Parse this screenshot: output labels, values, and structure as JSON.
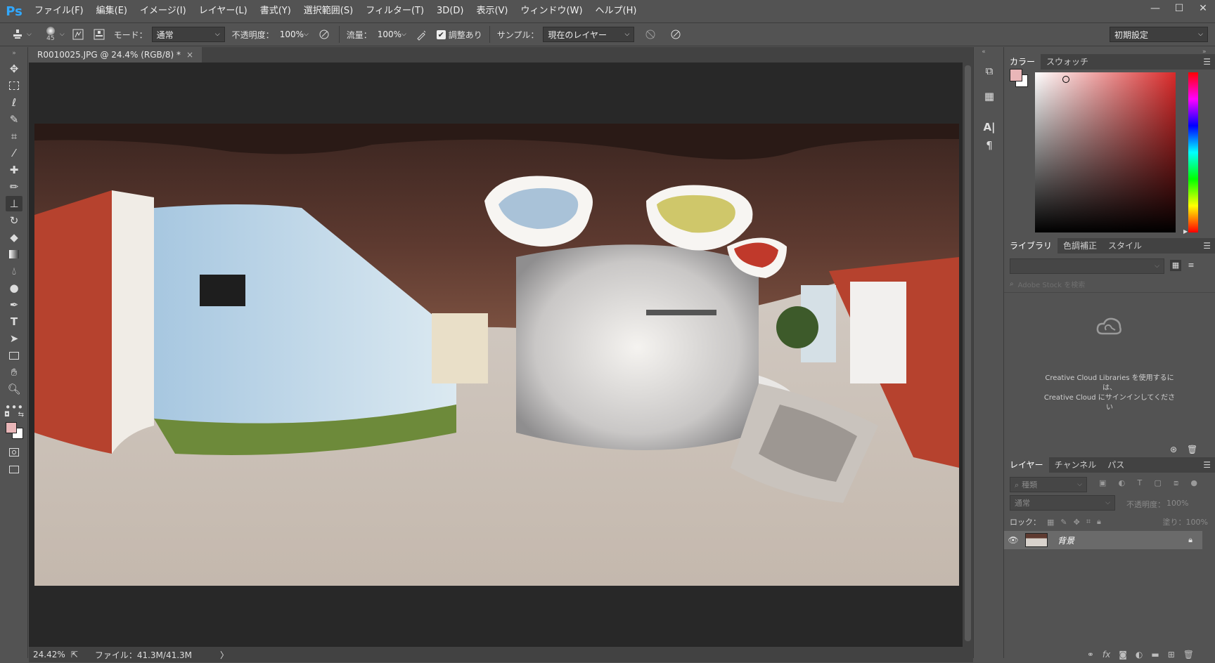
{
  "app": {
    "logo": "Ps"
  },
  "menu": [
    "ファイル(F)",
    "編集(E)",
    "イメージ(I)",
    "レイヤー(L)",
    "書式(Y)",
    "選択範囲(S)",
    "フィルター(T)",
    "3D(D)",
    "表示(V)",
    "ウィンドウ(W)",
    "ヘルプ(H)"
  ],
  "window_controls": {
    "minimize": "—",
    "restore": "☐",
    "close": "✕"
  },
  "options": {
    "brush_size": "45",
    "mode_label": "モード：",
    "mode_value": "通常",
    "opacity_label": "不透明度：",
    "opacity_value": "100%",
    "flow_label": "流量：",
    "flow_value": "100%",
    "aligned_label": "調整あり",
    "aligned_checked": true,
    "sample_label": "サンプル：",
    "sample_value": "現在のレイヤー",
    "workspace_value": "初期設定"
  },
  "document": {
    "tab_title": "R0010025.JPG @ 24.4% (RGB/8) *",
    "close_glyph": "×",
    "zoom": "24.42%",
    "file_info": "ファイル：41.3M/41.3M",
    "status_arrow": "〉"
  },
  "colors": {
    "foreground": "#e9b6b8",
    "background": "#ffffff",
    "picker_hue": "#d92a2a"
  },
  "color_panel": {
    "tabs": [
      "カラー",
      "スウォッチ"
    ]
  },
  "libraries_panel": {
    "tabs": [
      "ライブラリ",
      "色調補正",
      "スタイル"
    ],
    "search_placeholder": "Adobe Stock を検索",
    "message_line1": "Creative Cloud Libraries を使用するに",
    "message_line2": "は、",
    "message_line3": "Creative Cloud にサインインしてくださ",
    "message_line4": "い"
  },
  "layers_panel": {
    "tabs": [
      "レイヤー",
      "チャンネル",
      "パス"
    ],
    "filter_label": "種類",
    "blend_mode": "通常",
    "opacity_label": "不透明度：",
    "opacity_value": "100%",
    "lock_label": "ロック：",
    "fill_label": "塗り：",
    "fill_value": "100%",
    "layers": [
      {
        "name": "背景",
        "visible": true,
        "locked": true
      }
    ]
  }
}
